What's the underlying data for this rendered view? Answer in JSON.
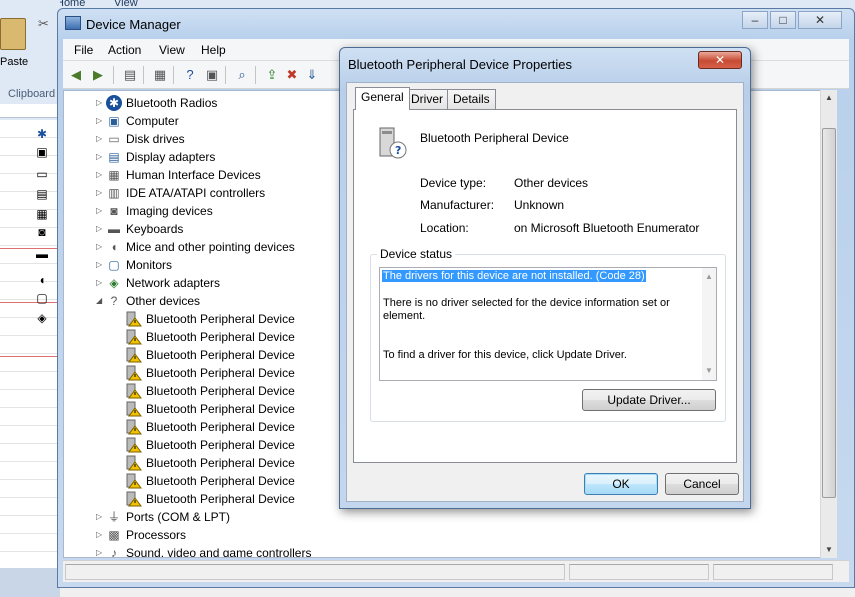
{
  "background_app": {
    "tab_home": "Home",
    "tab_view": "View",
    "paste_label": "Paste",
    "clipboard_label": "Clipboard"
  },
  "device_manager": {
    "title": "Device Manager",
    "menu": [
      "File",
      "Action",
      "View",
      "Help"
    ],
    "tree": {
      "categories_before": [
        {
          "label": "Bluetooth Radios",
          "icon": "bluetooth-icon"
        },
        {
          "label": "Computer",
          "icon": "computer-icon"
        },
        {
          "label": "Disk drives",
          "icon": "disk-drive-icon"
        },
        {
          "label": "Display adapters",
          "icon": "display-adapter-icon"
        },
        {
          "label": "Human Interface Devices",
          "icon": "hid-icon"
        },
        {
          "label": "IDE ATA/ATAPI controllers",
          "icon": "ide-controller-icon"
        },
        {
          "label": "Imaging devices",
          "icon": "camera-icon"
        },
        {
          "label": "Keyboards",
          "icon": "keyboard-icon"
        },
        {
          "label": "Mice and other pointing devices",
          "icon": "mouse-icon"
        },
        {
          "label": "Monitors",
          "icon": "monitor-icon"
        },
        {
          "label": "Network adapters",
          "icon": "network-adapter-icon"
        }
      ],
      "other_devices": {
        "label": "Other devices",
        "children": [
          "Bluetooth Peripheral Device",
          "Bluetooth Peripheral Device",
          "Bluetooth Peripheral Device",
          "Bluetooth Peripheral Device",
          "Bluetooth Peripheral Device",
          "Bluetooth Peripheral Device",
          "Bluetooth Peripheral Device",
          "Bluetooth Peripheral Device",
          "Bluetooth Peripheral Device",
          "Bluetooth Peripheral Device",
          "Bluetooth Peripheral Device"
        ]
      },
      "categories_after": [
        {
          "label": "Ports (COM & LPT)",
          "icon": "port-icon"
        },
        {
          "label": "Processors",
          "icon": "processor-icon"
        },
        {
          "label": "Sound, video and game controllers",
          "icon": "sound-icon"
        }
      ]
    }
  },
  "dialog": {
    "title": "Bluetooth Peripheral Device Properties",
    "close_label": "✕",
    "tabs": [
      "General",
      "Driver",
      "Details"
    ],
    "device_name": "Bluetooth Peripheral Device",
    "properties": [
      {
        "label": "Device type:",
        "value": "Other devices"
      },
      {
        "label": "Manufacturer:",
        "value": "Unknown"
      },
      {
        "label": "Location:",
        "value": "on Microsoft Bluetooth Enumerator"
      }
    ],
    "status_group_title": "Device status",
    "status_lines": [
      "The drivers for this device are not installed. (Code 28)",
      "There is no driver selected for the device information set or",
      "element.",
      "To find a driver for this device, click Update Driver."
    ],
    "update_driver_label": "Update Driver...",
    "ok_label": "OK",
    "cancel_label": "Cancel"
  }
}
